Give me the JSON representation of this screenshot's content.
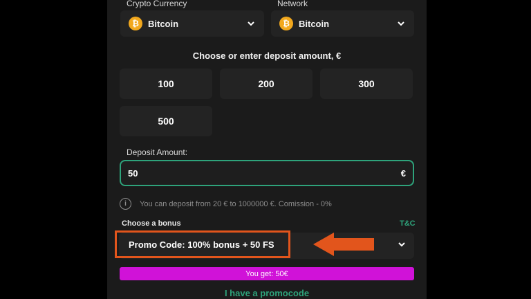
{
  "crypto": {
    "label": "Crypto Currency",
    "value": "Bitcoin",
    "icon": "bitcoin-icon"
  },
  "network": {
    "label": "Network",
    "value": "Bitcoin",
    "icon": "bitcoin-icon"
  },
  "amounts": {
    "heading": "Choose or enter deposit amount, €",
    "options": [
      "100",
      "200",
      "300",
      "500"
    ]
  },
  "deposit": {
    "label": "Deposit Amount:",
    "value": "50",
    "currency": "€"
  },
  "info": {
    "text": "You can deposit from 20 € to 1000000 €. Comission - 0%"
  },
  "bonus": {
    "label": "Choose a bonus",
    "tc": "T&C",
    "selected": "Promo Code: 100% bonus + 50 FS"
  },
  "summary": {
    "you_get": "You get: 50€"
  },
  "promocode_link": "I have a promocode",
  "colors": {
    "accent_green": "#2ea37b",
    "highlight_orange": "#e2551c",
    "get_bar_magenta": "#d012d8",
    "bitcoin_orange": "#f2a81d"
  }
}
